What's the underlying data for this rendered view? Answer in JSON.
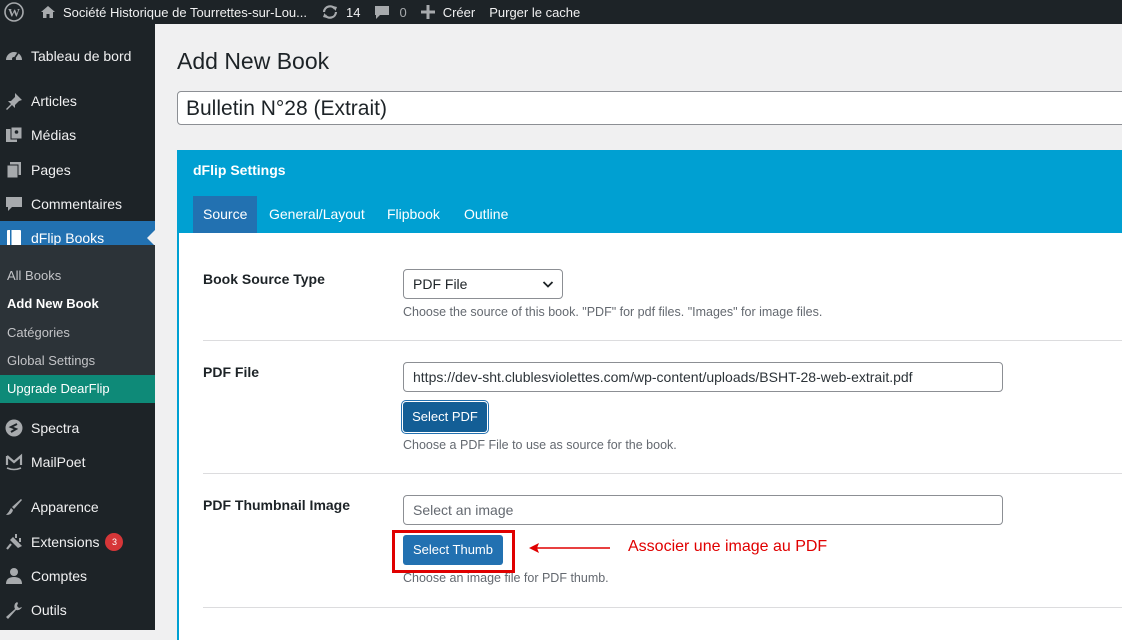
{
  "adminbar": {
    "site_name": "Société Historique de Tourrettes-sur-Lou...",
    "updates_count": "14",
    "comments_count": "0",
    "new_label": "Créer",
    "purge_label": "Purger le cache"
  },
  "sidebar": {
    "items": [
      {
        "label": "Tableau de bord",
        "icon": "dashboard-icon"
      },
      {
        "label": "Articles",
        "icon": "pin-icon"
      },
      {
        "label": "Médias",
        "icon": "media-icon"
      },
      {
        "label": "Pages",
        "icon": "pages-icon"
      },
      {
        "label": "Commentaires",
        "icon": "comment-icon"
      },
      {
        "label": "dFlip Books",
        "icon": "book-icon"
      },
      {
        "label": "Spectra",
        "icon": "spectra-icon"
      },
      {
        "label": "MailPoet",
        "icon": "mailpoet-icon"
      },
      {
        "label": "Apparence",
        "icon": "brush-icon"
      },
      {
        "label": "Extensions",
        "icon": "plugin-icon",
        "badge": "3"
      },
      {
        "label": "Comptes",
        "icon": "user-icon"
      },
      {
        "label": "Outils",
        "icon": "wrench-icon"
      }
    ],
    "submenu": [
      {
        "label": "All Books"
      },
      {
        "label": "Add New Book"
      },
      {
        "label": "Catégories"
      },
      {
        "label": "Global Settings"
      },
      {
        "label": "Upgrade DearFlip"
      }
    ]
  },
  "page": {
    "title": "Add New Book",
    "book_title_value": "Bulletin N°28 (Extrait)"
  },
  "panel": {
    "title": "dFlip Settings",
    "tabs": [
      "Source",
      "General/Layout",
      "Flipbook",
      "Outline"
    ],
    "source_type": {
      "label": "Book Source Type",
      "value": "PDF File",
      "description": "Choose the source of this book. \"PDF\" for pdf files. \"Images\" for image files."
    },
    "pdf_file": {
      "label": "PDF File",
      "value": "https://dev-sht.clublesviolettes.com/wp-content/uploads/BSHT-28-web-extrait.pdf",
      "button": "Select PDF",
      "description": "Choose a PDF File to use as source for the book."
    },
    "pdf_thumb": {
      "label": "PDF Thumbnail Image",
      "placeholder": "Select an image",
      "button": "Select Thumb",
      "description": "Choose an image file for PDF thumb."
    }
  },
  "annotation": {
    "text": "Associer une image au PDF",
    "color": "#e00000"
  }
}
